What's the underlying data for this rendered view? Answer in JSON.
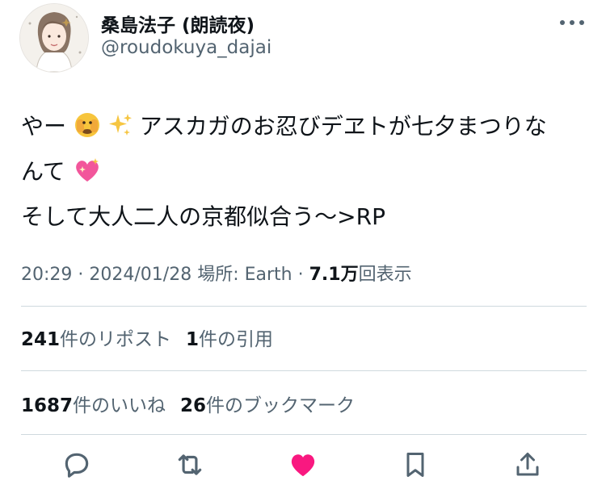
{
  "author": {
    "display_name": "桑島法子 (朗読夜)",
    "handle": "@roudokuya_dajai"
  },
  "tweet": {
    "line1_a": "やー",
    "line1_b": "アスカガのお忍びデヱトが七夕まつりな",
    "line2": "んて",
    "line3": "そして大人二人の京都似合う〜>RP",
    "emoji_1": "face-with-peeking-eye-emoji",
    "emoji_2": "sparkles-emoji",
    "emoji_3": "sparkling-heart-emoji"
  },
  "meta": {
    "time": "20:29",
    "sep1": " · ",
    "date": "2024/01/28",
    "location": " 場所: Earth",
    "sep2": " · ",
    "views_count": "7.1万",
    "views_label": "回表示"
  },
  "stats": {
    "reposts_count": "241",
    "reposts_label": "件のリポスト",
    "quotes_count": "1",
    "quotes_label": "件の引用",
    "likes_count": "1687",
    "likes_label": "件のいいね",
    "bookmarks_count": "26",
    "bookmarks_label": "件のブックマーク"
  },
  "actions": {
    "reply_icon": "speech-bubble-icon",
    "repost_icon": "repost-arrows-icon",
    "like_icon": "heart-icon",
    "bookmark_icon": "bookmark-icon",
    "share_icon": "share-upload-icon",
    "like_active": true
  },
  "colors": {
    "text_primary": "#0f1419",
    "text_secondary": "#536471",
    "divider": "#cfd9de",
    "like_pink": "#f91880",
    "icon_gray": "#536471"
  }
}
